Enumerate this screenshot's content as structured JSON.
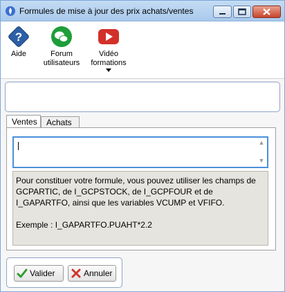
{
  "window": {
    "title": "Formules de mise à jour des prix achats/ventes"
  },
  "toolbar": {
    "aide_label": "Aide",
    "forum_label_line1": "Forum",
    "forum_label_line2": "utilisateurs",
    "video_label_line1": "Vidéo",
    "video_label_line2": "formations"
  },
  "tabs": [
    {
      "label": "Ventes",
      "selected": true
    },
    {
      "label": "Achats",
      "selected": false
    }
  ],
  "formula": {
    "value": ""
  },
  "help": {
    "text": "Pour constituer votre formule, vous pouvez utiliser les champs de GCPARTIC, de I_GCPSTOCK, de I_GCPFOUR et de I_GAPARTFO, ainsi que les variables VCUMP et VFIFO.",
    "example": "Exemple : I_GAPARTFO.PUAHT*2.2"
  },
  "buttons": {
    "valider_label": "Valider",
    "annuler_label": "Annuler"
  },
  "colors": {
    "title_bar": "#a9c9ec",
    "help_background": "#e6e4de",
    "input_focus_border": "#4a90d9",
    "panel_border": "#8fa3c8"
  },
  "icons": {
    "window": "app-flame-icon",
    "aide": "help-question-icon",
    "forum": "chat-bubbles-icon",
    "video": "video-play-icon",
    "valider": "checkmark-icon",
    "annuler": "cross-icon"
  }
}
